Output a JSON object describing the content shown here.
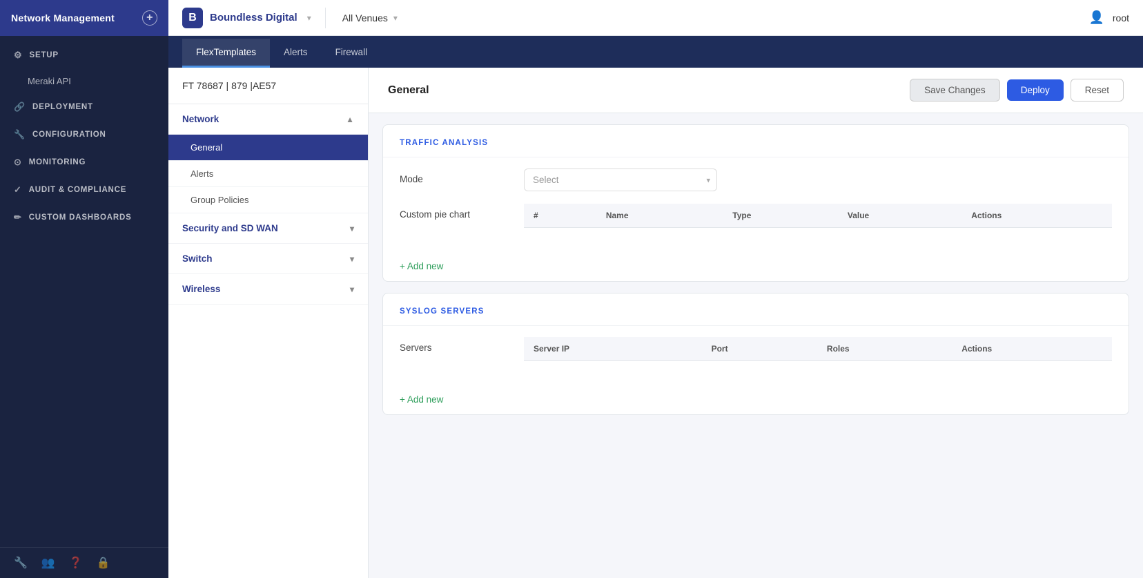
{
  "sidebar": {
    "app_title": "Network Management",
    "add_btn_label": "+",
    "sections": [
      {
        "id": "setup",
        "label": "SETUP",
        "icon": "⚙"
      },
      {
        "id": "meraki_api",
        "label": "Meraki API",
        "type": "sub"
      },
      {
        "id": "deployment",
        "label": "DEPLOYMENT",
        "icon": "🔗"
      },
      {
        "id": "configuration",
        "label": "CONFIGURATION",
        "icon": "🔧"
      },
      {
        "id": "monitoring",
        "label": "MONITORING",
        "icon": "⊙"
      },
      {
        "id": "audit_compliance",
        "label": "AUDIT & COMPLIANCE",
        "icon": "✓"
      },
      {
        "id": "custom_dashboards",
        "label": "CUSTOM DASHBOARDS",
        "icon": "✏"
      }
    ],
    "footer_icons": [
      "🔧",
      "👥",
      "❓",
      "🔒"
    ]
  },
  "header": {
    "brand_logo": "B",
    "brand_name": "Boundless Digital",
    "brand_chevron": "▾",
    "venue_name": "All Venues",
    "venue_chevron": "▾",
    "user_icon": "👤",
    "user_name": "root"
  },
  "tabs": [
    {
      "id": "flex_templates",
      "label": "FlexTemplates",
      "active": true
    },
    {
      "id": "alerts",
      "label": "Alerts",
      "active": false
    },
    {
      "id": "firewall",
      "label": "Firewall",
      "active": false
    }
  ],
  "left_panel": {
    "template_id": "FT 78687 | 879 |AE57",
    "nav_sections": [
      {
        "id": "network",
        "label": "Network",
        "expanded": true,
        "chevron": "▲",
        "sub_items": [
          {
            "id": "general",
            "label": "General",
            "active": true
          },
          {
            "id": "alerts",
            "label": "Alerts",
            "active": false
          },
          {
            "id": "group_policies",
            "label": "Group Policies",
            "active": false
          }
        ]
      },
      {
        "id": "security_sd_wan",
        "label": "Security and SD WAN",
        "expanded": false,
        "chevron": "▾"
      },
      {
        "id": "switch",
        "label": "Switch",
        "expanded": false,
        "chevron": "▾"
      },
      {
        "id": "wireless",
        "label": "Wireless",
        "expanded": false,
        "chevron": "▾"
      }
    ]
  },
  "right_panel": {
    "title": "General",
    "actions": {
      "save_label": "Save Changes",
      "deploy_label": "Deploy",
      "reset_label": "Reset"
    },
    "sections": [
      {
        "id": "traffic_analysis",
        "title": "TRAFFIC ANALYSIS",
        "fields": [
          {
            "id": "mode",
            "label": "Mode",
            "type": "select",
            "placeholder": "Select"
          },
          {
            "id": "custom_pie_chart",
            "label": "Custom pie chart",
            "type": "table",
            "columns": [
              "#",
              "Name",
              "Type",
              "Value",
              "Actions"
            ],
            "rows": []
          }
        ],
        "add_new_label": "+ Add new"
      },
      {
        "id": "syslog_servers",
        "title": "SYSLOG SERVERS",
        "fields": [
          {
            "id": "servers",
            "label": "Servers",
            "type": "table",
            "columns": [
              "Server IP",
              "Port",
              "Roles",
              "Actions"
            ],
            "rows": []
          }
        ],
        "add_new_label": "+ Add new"
      }
    ]
  }
}
